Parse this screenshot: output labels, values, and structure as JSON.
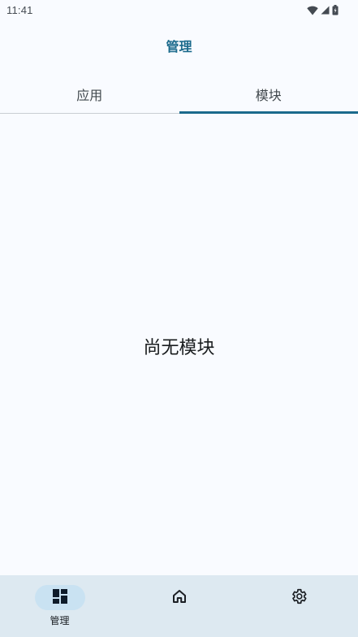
{
  "status_bar": {
    "time": "11:41"
  },
  "header": {
    "title": "管理"
  },
  "tabs": [
    {
      "label": "应用",
      "active": false
    },
    {
      "label": "模块",
      "active": true
    }
  ],
  "main": {
    "empty_message": "尚无模块"
  },
  "bottom_nav": {
    "items": [
      {
        "label": "管理",
        "icon": "dashboard-icon",
        "active": true
      },
      {
        "label": "",
        "icon": "home-icon",
        "active": false
      },
      {
        "label": "",
        "icon": "gear-icon",
        "active": false
      }
    ]
  },
  "colors": {
    "accent": "#1b6a8c",
    "background": "#f9fbff",
    "nav_background": "#dde9f1",
    "nav_active_pill": "#c9e2f2"
  }
}
